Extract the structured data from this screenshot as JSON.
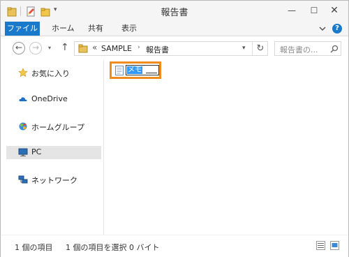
{
  "window": {
    "title": "報告書",
    "controls": {
      "minimize": "—",
      "maximize": "☐",
      "close": "✕"
    }
  },
  "quick_access": {
    "dropdown": "▾"
  },
  "ribbon": {
    "tabs": [
      "ファイル",
      "ホーム",
      "共有",
      "表示"
    ],
    "help": "?"
  },
  "navigation": {
    "back": "←",
    "forward": "→",
    "recent": "▾",
    "up": "↑",
    "address": {
      "overflow": "«",
      "crumbs": [
        "SAMPLE",
        "報告書"
      ],
      "separator": "›",
      "dropdown": "▾",
      "refresh": "↻"
    },
    "search": {
      "placeholder": "報告書の..."
    }
  },
  "sidebar": {
    "items": [
      {
        "label": "お気に入り",
        "icon": "star-icon"
      },
      {
        "label": "OneDrive",
        "icon": "cloud-icon"
      },
      {
        "label": "ホームグループ",
        "icon": "homegroup-icon"
      },
      {
        "label": "PC",
        "icon": "computer-icon",
        "selected": true
      },
      {
        "label": "ネットワーク",
        "icon": "network-icon"
      }
    ]
  },
  "files": [
    {
      "name": "メモ",
      "icon": "text-document-icon",
      "state": "renaming"
    }
  ],
  "status": {
    "item_count": "1 個の項目",
    "selection": "1 個の項目を選択  0 バイト"
  },
  "colors": {
    "accent": "#1979ca",
    "highlight_border": "#f08c1e",
    "selection": "#3399ff"
  }
}
